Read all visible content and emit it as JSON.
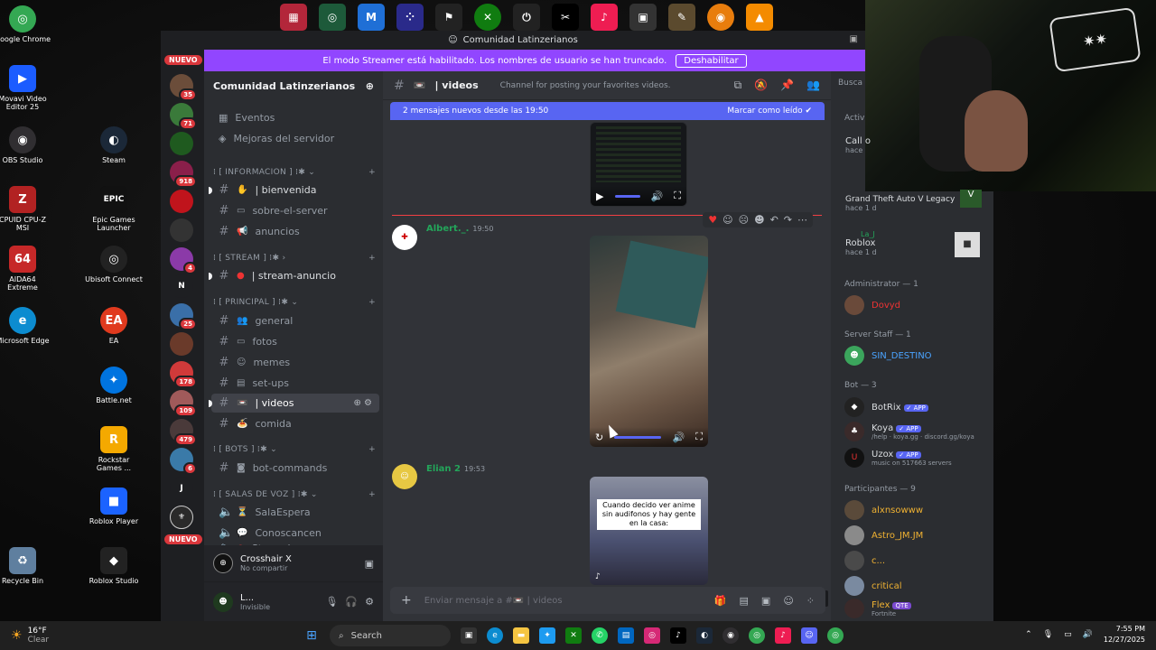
{
  "desktop": {
    "left_icons": [
      {
        "label": "Google Chrome",
        "color": "#34a853",
        "glyph": "◎"
      },
      {
        "label": "Movavi Video Editor 25",
        "color": "#1b5cff",
        "glyph": "▶"
      },
      {
        "label": "OBS Studio",
        "color": "#302e31",
        "glyph": "◉"
      },
      {
        "label": "CPUID CPU-Z MSI",
        "color": "#b22222",
        "glyph": "Z"
      },
      {
        "label": "AIDA64 Extreme",
        "color": "#c62828",
        "glyph": "64"
      },
      {
        "label": "Microsoft Edge",
        "color": "#0c8cd0",
        "glyph": "e"
      },
      {
        "label": "Recycle Bin",
        "color": "#5f7f9f",
        "glyph": "♻"
      }
    ],
    "right_icons": [
      {
        "label": "Steam",
        "color": "#1b2838",
        "glyph": "◐"
      },
      {
        "label": "Epic Games Launcher",
        "color": "#111",
        "glyph": "EPIC"
      },
      {
        "label": "Ubisoft Connect",
        "color": "#222",
        "glyph": "◎"
      },
      {
        "label": "EA",
        "color": "#e03a1e",
        "glyph": "EA"
      },
      {
        "label": "Battle.net",
        "color": "#0074e0",
        "glyph": "✦"
      },
      {
        "label": "Rockstar Games ...",
        "color": "#f4a900",
        "glyph": "R"
      },
      {
        "label": "Roblox Player",
        "color": "#1b63ff",
        "glyph": "■"
      },
      {
        "label": "Roblox Studio",
        "color": "#222",
        "glyph": "◆"
      }
    ]
  },
  "window": {
    "title": "Comunidad Latinzerianos",
    "streamer_notice": "El modo Streamer está habilitado. Los nombres de usuario se han truncado.",
    "streamer_button": "Deshabilitar"
  },
  "rail": {
    "badges": [
      "NUEVO",
      "35",
      "71",
      "918",
      "25",
      "479",
      "109",
      "178",
      "6",
      "4"
    ],
    "nuevo_bottom": "NUEVO",
    "letters": [
      "N",
      "J"
    ]
  },
  "sidebar": {
    "server_name": "Comunidad Latinzerianos",
    "events": "Eventos",
    "boosts": "Mejoras del servidor",
    "categories": [
      "⁞ [ INFORMACION ] ⁞✱ ⌄",
      "⁞ [ STREAM ] ⁞✱ ›",
      "⁞ [ PRINCIPAL ] ⁞✱ ⌄",
      "⁞ [ BOTS ] ⁞✱ ⌄",
      "⁞ [ SALAS DE VOZ ] ⁞✱ ⌄"
    ],
    "channels": {
      "bienvenida": "| bienvenida",
      "sobre": "sobre-el-server",
      "anuncios": "anuncios",
      "stream": "| stream-anuncio",
      "general": "general",
      "fotos": "fotos",
      "memes": "memes",
      "setups": "set-ups",
      "videos": "| videos",
      "comida": "comida",
      "bot": "bot-commands",
      "sala1": "SalaEspera",
      "sala2": "Conoscancen",
      "sala3": "Streaming"
    },
    "voice_title": "Crosshair X",
    "voice_sub": "No compartir",
    "user_name": "L...",
    "user_status": "Invisible"
  },
  "chat": {
    "channel": "| videos",
    "topic": "Channel for posting your favorites videos.",
    "search_placeholder": "Busca",
    "new_messages": "2 mensajes nuevos desde las 19:50",
    "mark_read": "Marcar como leído",
    "msg1_author": "Albert._.",
    "msg1_time": "19:50",
    "msg2_author": "Elian 2",
    "msg2_time": "19:53",
    "meme_caption": "Cuando decido ver anime sin audifonos y hay gente en la casa:",
    "input_placeholder": "Enviar mensaje a #📼 | videos"
  },
  "members": {
    "activity_header": "Activ",
    "act1": "Call o",
    "act1_time": "hace",
    "act2_title": "Grand Theft Auto V Legacy",
    "act2_time": "hace 1 d",
    "act3_user": "La_J",
    "act3_title": "Roblox",
    "act3_time": "hace 1 d",
    "admin_header": "Administrator — 1",
    "admin": "Dovyd",
    "staff_header": "Server Staff — 1",
    "staff": "SIN_DESTINO",
    "bot_header": "Bot — 3",
    "bot1": "BotRix",
    "bot2": "Koya",
    "bot2_sub": "/help · koya.gg · discord.gg/koya",
    "bot3": "Uzox",
    "bot3_sub": "music on 517663 servers",
    "app_badge": "✓ APP",
    "part_header": "Participantes — 9",
    "p1": "alxnsowww",
    "p2": "Astro_JM.JM",
    "p3": "c...",
    "p4": "critical",
    "p5": "Flex",
    "p5_sub": "Fortnite",
    "p5_tag": "QTE"
  },
  "taskbar": {
    "temp": "16°F",
    "weather": "Clear",
    "search": "Search",
    "time": "7:55 PM",
    "date": "12/27/2025"
  }
}
